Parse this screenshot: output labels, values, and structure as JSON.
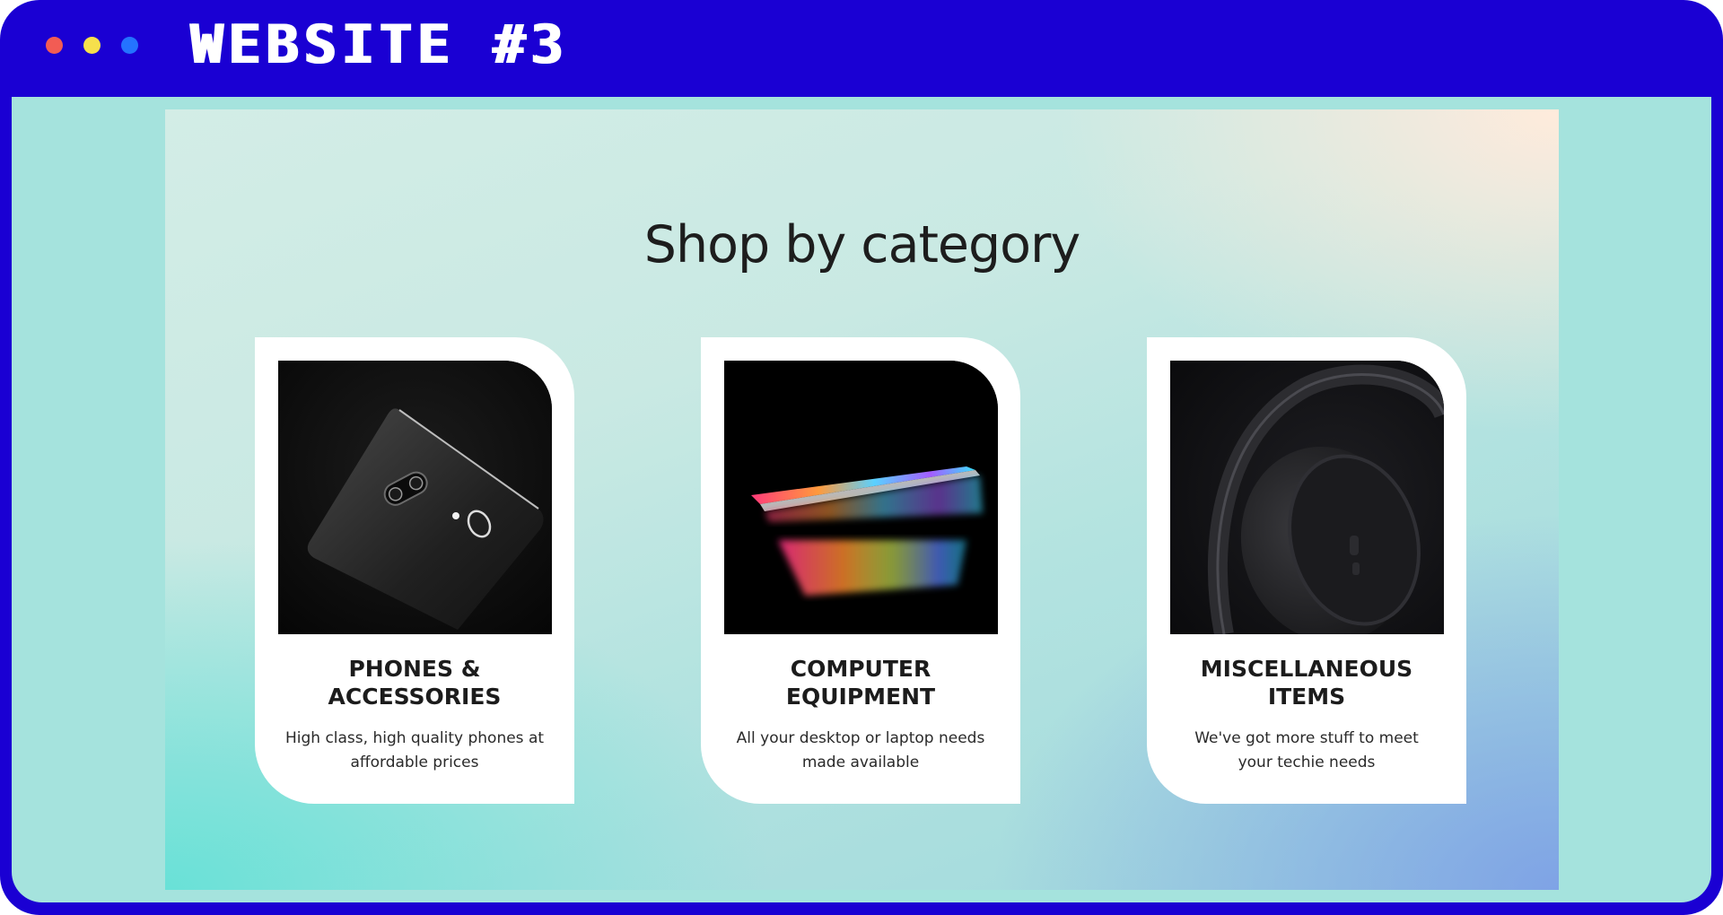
{
  "window": {
    "title": "WEBSITE #3",
    "controls": [
      {
        "name": "close",
        "color": "#f25c54"
      },
      {
        "name": "minimize",
        "color": "#f6e04c"
      },
      {
        "name": "maximize",
        "color": "#2473ff"
      }
    ]
  },
  "colors": {
    "frame": "#1a00d3",
    "viewport_background": "#a5e3dd",
    "card_background": "#ffffff",
    "text": "#1c1c1c"
  },
  "page": {
    "heading": "Shop by category",
    "categories": [
      {
        "title_lines": [
          "PHONES &",
          "ACCESSORIES"
        ],
        "description_lines": [
          "High class, high quality phones at",
          "affordable prices"
        ],
        "image": "black-smartphone-photo"
      },
      {
        "title_lines": [
          "COMPUTER",
          "EQUIPMENT"
        ],
        "description_lines": [
          "All your desktop or laptop needs",
          "made available"
        ],
        "image": "laptop-rainbow-screen-photo"
      },
      {
        "title_lines": [
          "MISCELLANEOUS",
          "ITEMS"
        ],
        "description_lines": [
          "We've got more stuff to meet",
          "your techie needs"
        ],
        "image": "headphones-photo"
      }
    ]
  }
}
